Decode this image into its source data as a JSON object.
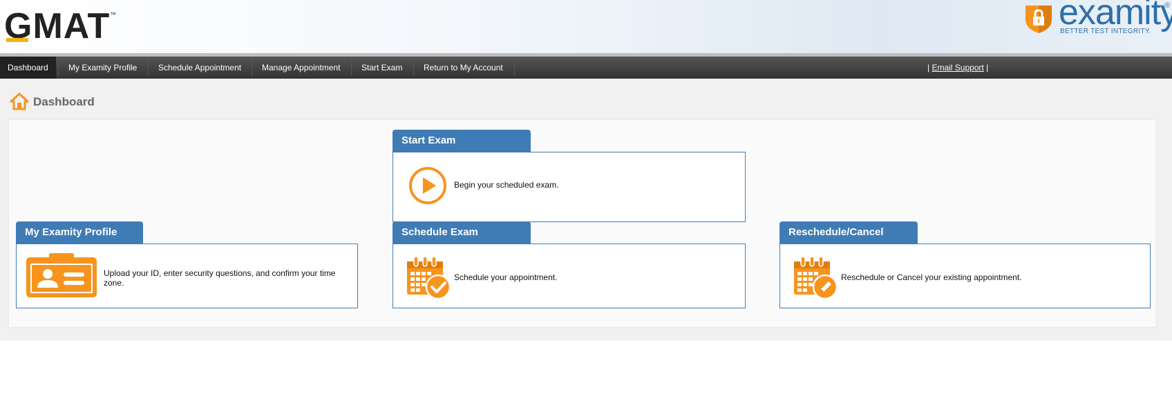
{
  "header": {
    "gmat_logo_text": "GMAT",
    "gmat_tm": "™",
    "examity_word": "examity",
    "examity_reg": "®",
    "examity_tagline": "BETTER TEST INTEGRITY."
  },
  "nav": {
    "items": [
      "Dashboard",
      "My Examity Profile",
      "Schedule Appointment",
      "Manage Appointment",
      "Start Exam",
      "Return to My Account"
    ],
    "active": "Dashboard",
    "support_prefix": "| ",
    "support_link": "Email Support",
    "support_suffix": " |"
  },
  "page": {
    "title": "Dashboard"
  },
  "cards": {
    "start_exam": {
      "title": "Start Exam",
      "text": "Begin your scheduled exam."
    },
    "profile": {
      "title": "My Examity Profile",
      "text": "Upload your ID, enter security questions, and confirm your time zone."
    },
    "schedule": {
      "title": "Schedule Exam",
      "text": "Schedule your appointment."
    },
    "reschedule": {
      "title": "Reschedule/Cancel",
      "text": "Reschedule or Cancel your existing appointment."
    }
  },
  "colors": {
    "accent_blue": "#3f7cb5",
    "icon_orange": "#f7941d",
    "gmat_yellow": "#f2b51a",
    "nav_dark": "#333333"
  },
  "icons": {
    "home": "home-icon",
    "play": "play-icon",
    "id_card": "id-card-icon",
    "calendar_check": "calendar-check-icon",
    "calendar_edit": "calendar-edit-icon",
    "shield_lock": "shield-lock-icon"
  }
}
